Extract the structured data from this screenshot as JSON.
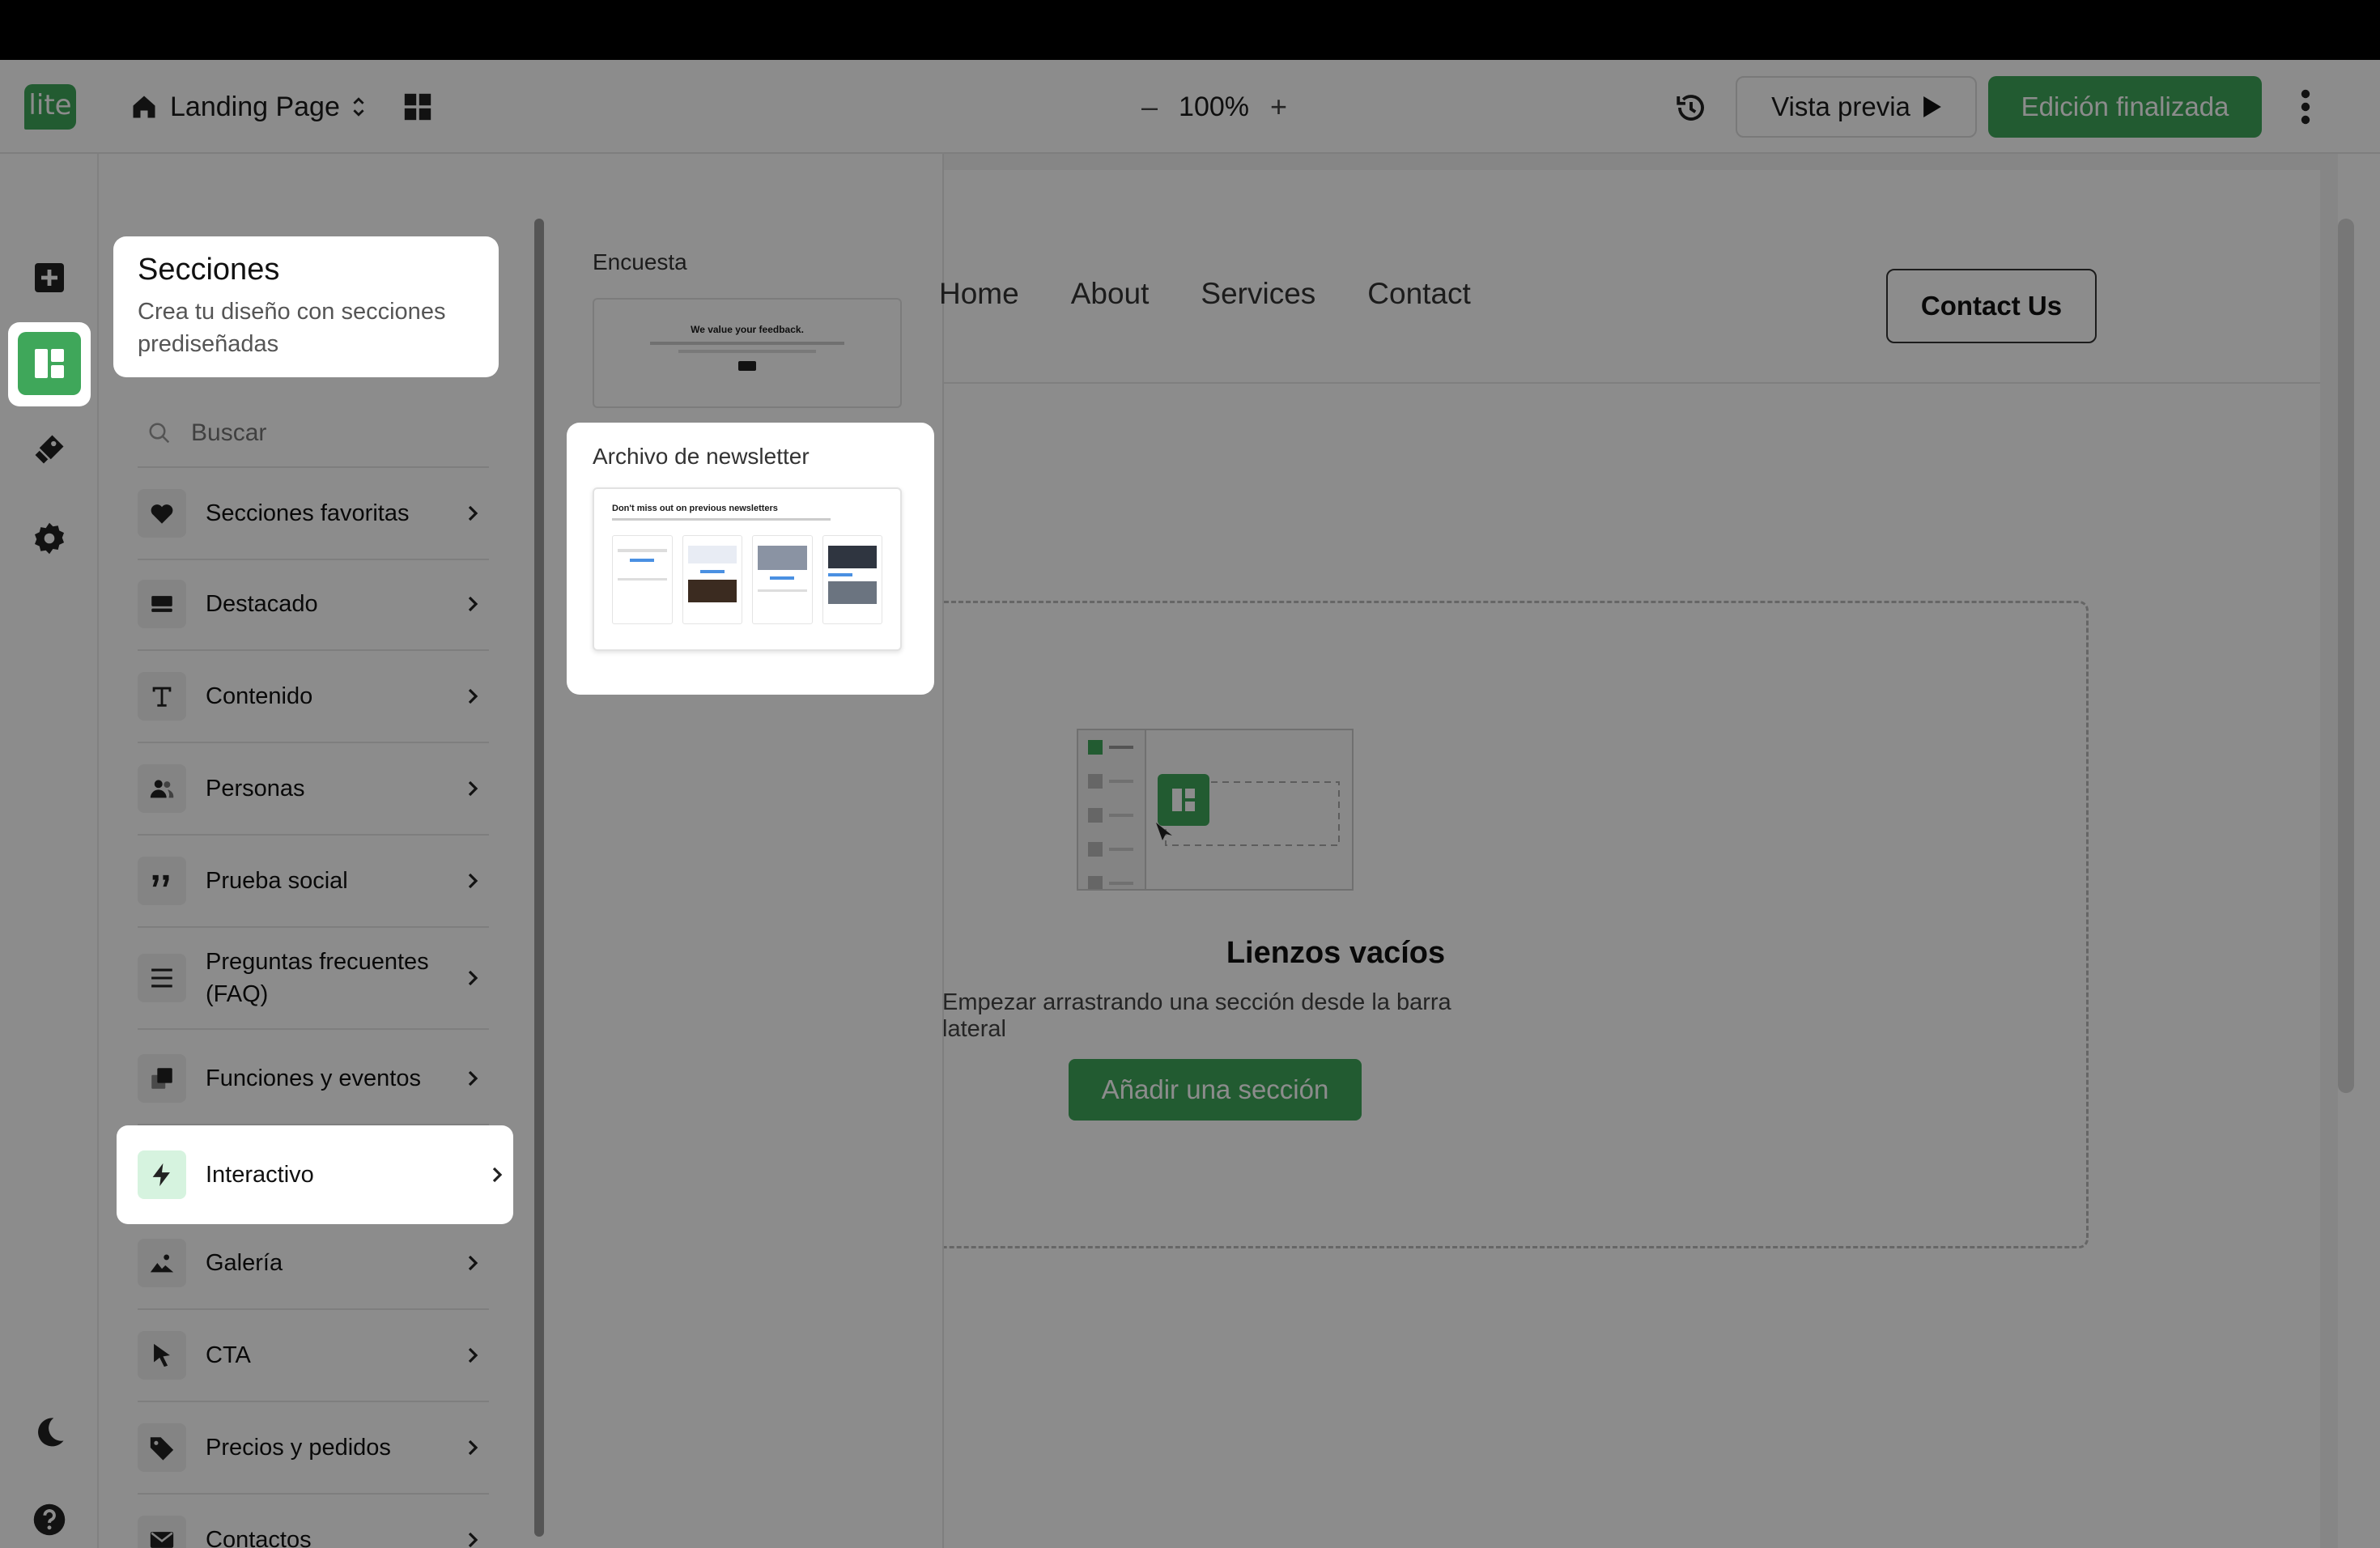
{
  "header": {
    "logo": "lite",
    "page_name": "Landing Page",
    "zoom": "100%",
    "zoom_out": "–",
    "zoom_in": "+",
    "preview_label": "Vista previa",
    "done_label": "Edición finalizada"
  },
  "sections_panel": {
    "title": "Secciones",
    "description": "Crea tu diseño con secciones prediseñadas",
    "search_placeholder": "Buscar",
    "items": [
      {
        "label": "Secciones favoritas",
        "icon": "heart-icon"
      },
      {
        "label": "Destacado",
        "icon": "hero-icon"
      },
      {
        "label": "Contenido",
        "icon": "text-icon"
      },
      {
        "label": "Personas",
        "icon": "people-icon"
      },
      {
        "label": "Prueba social",
        "icon": "quote-icon"
      },
      {
        "label": "Preguntas frecuentes (FAQ)",
        "icon": "list-icon"
      },
      {
        "label": "Funciones y eventos",
        "icon": "features-icon"
      },
      {
        "label": "Interactivo",
        "icon": "bolt-icon"
      },
      {
        "label": "Galería",
        "icon": "image-icon"
      },
      {
        "label": "CTA",
        "icon": "cursor-icon"
      },
      {
        "label": "Precios y pedidos",
        "icon": "tag-icon"
      },
      {
        "label": "Contactos",
        "icon": "mail-icon"
      }
    ]
  },
  "variants": {
    "survey": {
      "label": "Encuesta",
      "thumb_title": "We value your feedback."
    },
    "newsletter": {
      "label": "Archivo de newsletter",
      "thumb_title": "Don't miss out on previous newsletters"
    }
  },
  "canvas": {
    "nav_links": [
      "Home",
      "About",
      "Services",
      "Contact"
    ],
    "contact_button": "Contact Us",
    "empty_title": "Lienzos vacíos",
    "empty_subtitle": "Empezar arrastrando una sección desde la barra lateral",
    "add_section": "Añadir una sección"
  },
  "colors": {
    "accent": "#3fa75a",
    "accent_light": "#d6f3df"
  }
}
